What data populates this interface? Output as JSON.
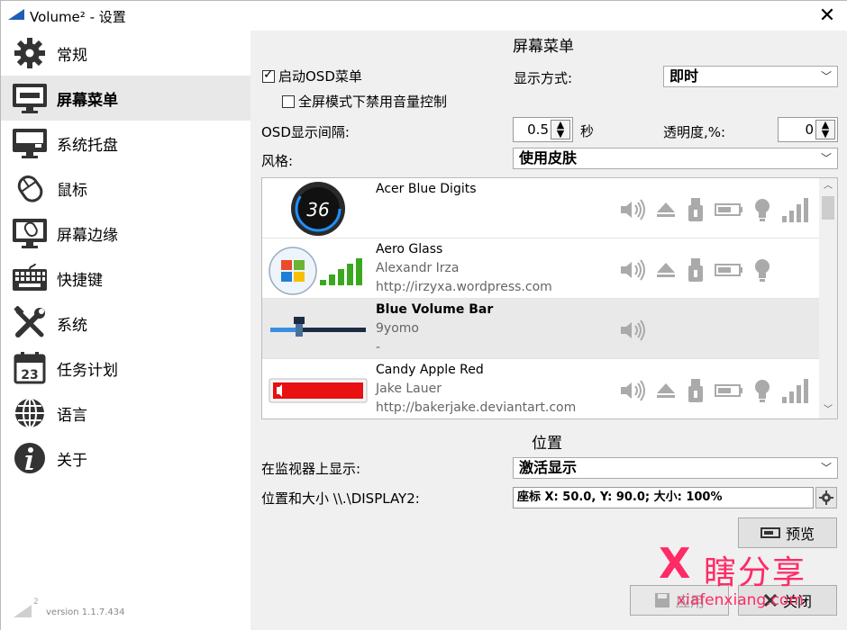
{
  "window": {
    "title": "Volume² - 设置",
    "close_label": "✕"
  },
  "sidebar": {
    "items": [
      {
        "label": "常规",
        "icon": "gear-icon"
      },
      {
        "label": "屏幕菜单",
        "icon": "monitor-icon",
        "selected": true
      },
      {
        "label": "系统托盘",
        "icon": "tray-icon"
      },
      {
        "label": "鼠标",
        "icon": "mouse-icon"
      },
      {
        "label": "屏幕边缘",
        "icon": "screen-edge-icon"
      },
      {
        "label": "快捷键",
        "icon": "keyboard-icon"
      },
      {
        "label": "系统",
        "icon": "tools-icon"
      },
      {
        "label": "任务计划",
        "icon": "calendar-icon"
      },
      {
        "label": "语言",
        "icon": "globe-icon"
      },
      {
        "label": "关于",
        "icon": "info-icon"
      }
    ],
    "calendar_day": "23",
    "version_logo_text": "2",
    "version": "version 1.1.7.434"
  },
  "osd": {
    "section_title": "屏幕菜单",
    "enable_label": "启动OSD菜单",
    "enable_checked": true,
    "fullscreen_label": "全屏模式下禁用音量控制",
    "fullscreen_checked": false,
    "display_mode_label": "显示方式:",
    "display_mode_value": "即时",
    "interval_label": "OSD显示间隔:",
    "interval_value": "0.5",
    "interval_unit": "秒",
    "opacity_label": "透明度,%:",
    "opacity_value": "0",
    "style_label": "风格:",
    "style_value": "使用皮肤"
  },
  "skins": [
    {
      "name": "Acer Blue Digits",
      "author": "",
      "url": "",
      "thumb_text": "36",
      "icons": [
        "speaker-icon",
        "eject-icon",
        "usb-icon",
        "battery-icon",
        "bulb-icon",
        "signal-bars-icon"
      ]
    },
    {
      "name": "Aero Glass",
      "author": "Alexandr Irza",
      "url": "http://irzyxa.wordpress.com",
      "thumb_text": "",
      "icons": [
        "speaker-icon",
        "eject-icon",
        "usb-icon",
        "battery-icon",
        "bulb-icon"
      ]
    },
    {
      "name": "Blue Volume Bar",
      "author": "9yomo",
      "url": "-",
      "thumb_text": "",
      "icons": [
        "speaker-icon"
      ],
      "selected": true
    },
    {
      "name": "Candy Apple Red",
      "author": "Jake Lauer",
      "url": "http://bakerjake.deviantart.com",
      "thumb_text": "",
      "icons": [
        "speaker-icon",
        "eject-icon",
        "usb-icon",
        "battery-icon",
        "bulb-icon",
        "signal-bars-icon"
      ]
    }
  ],
  "position": {
    "section_title": "位置",
    "monitor_label": "在监视器上显示:",
    "monitor_value": "激活显示",
    "pos_label": "位置和大小 \\\\.\\DISPLAY2:",
    "pos_value": "座标 X: 50.0, Y: 90.0; 大小: 100%"
  },
  "buttons": {
    "preview": "预览",
    "apply": "应用",
    "close": "关闭"
  },
  "watermark": {
    "logo": "X",
    "name": "瞎分享",
    "url": "xiafenxiang.com"
  },
  "colors": {
    "accent": "#1e5fb4",
    "watermark": "#ff2a66",
    "selected_bg": "#e8e8e8",
    "content_bg": "#f0f0f0"
  }
}
